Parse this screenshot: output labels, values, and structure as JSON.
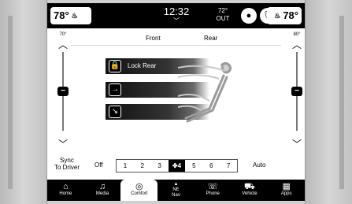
{
  "status_bar": {
    "driver_temp": "78°",
    "clock": "12:32",
    "outside_temp": "72°",
    "outside_label": "OUT",
    "passenger_temp": "78°"
  },
  "climate": {
    "zones": {
      "front": "Front",
      "rear": "Rear"
    },
    "left_temp_label": "70°",
    "right_temp_label": "80°",
    "modes": [
      {
        "label": "Lock Rear",
        "icon": "lock-icon"
      },
      {
        "label": "",
        "icon": "arrow-right-icon"
      },
      {
        "label": "",
        "icon": "arrow-down-right-icon"
      }
    ],
    "sync_label_line1": "Sync",
    "sync_label_line2": "To Driver",
    "fan": {
      "off_label": "Off",
      "levels": [
        "1",
        "2",
        "3",
        "4",
        "5",
        "6",
        "7"
      ],
      "selected_level": 4,
      "auto_label": "Auto"
    }
  },
  "nav": {
    "items": [
      {
        "label": "Home",
        "icon": "home-icon"
      },
      {
        "label": "Media",
        "icon": "music-note-icon"
      },
      {
        "label": "Comfort",
        "icon": "comfort-icon"
      },
      {
        "label_line1": "NE",
        "label_line2": "Nav",
        "icon": "compass-icon"
      },
      {
        "label": "Phone",
        "icon": "phone-icon"
      },
      {
        "label": "Vehicle",
        "icon": "car-icon"
      },
      {
        "label": "Apps",
        "icon": "apps-grid-icon"
      }
    ],
    "active_index": 2
  }
}
